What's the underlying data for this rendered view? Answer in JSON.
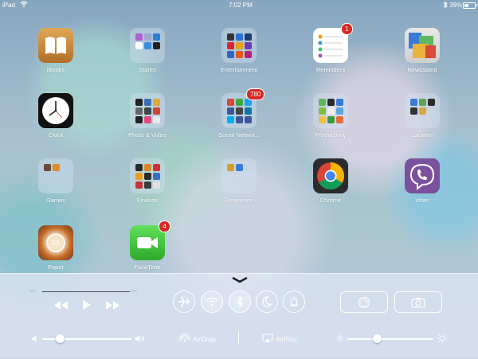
{
  "status_bar": {
    "device": "iPad",
    "time": "7:02 PM",
    "battery_text": "39%",
    "battery_level": 0.39
  },
  "apps": [
    {
      "label": "iBooks",
      "icon": "ibooks-icon"
    },
    {
      "label": "Stores",
      "icon": "folder-icon"
    },
    {
      "label": "Entertainment",
      "icon": "folder-icon"
    },
    {
      "label": "Reminders",
      "icon": "reminders-icon",
      "badge": "1"
    },
    {
      "label": "Newsstand",
      "icon": "newsstand-icon"
    },
    {
      "label": "Clock",
      "icon": "clock-icon"
    },
    {
      "label": "Photo & Video",
      "icon": "folder-icon"
    },
    {
      "label": "Social Networ...",
      "icon": "folder-icon",
      "badge": "780"
    },
    {
      "label": "Productivity",
      "icon": "folder-icon"
    },
    {
      "label": "Location",
      "icon": "folder-icon"
    },
    {
      "label": "Games",
      "icon": "folder-icon"
    },
    {
      "label": "Finance",
      "icon": "folder-icon"
    },
    {
      "label": "Reference",
      "icon": "folder-icon"
    },
    {
      "label": "Chrome",
      "icon": "chrome-icon"
    },
    {
      "label": "Viber",
      "icon": "viber-icon"
    },
    {
      "label": "Paper",
      "icon": "paper-icon"
    },
    {
      "label": "FaceTime",
      "icon": "facetime-icon",
      "badge": "4"
    }
  ],
  "control_center": {
    "elapsed": "--:--",
    "remaining": "--:--",
    "toggles": [
      {
        "name": "airplane-mode-toggle",
        "state": "off"
      },
      {
        "name": "wifi-toggle",
        "state": "on"
      },
      {
        "name": "bluetooth-toggle",
        "state": "on"
      },
      {
        "name": "do-not-disturb-toggle",
        "state": "off"
      },
      {
        "name": "rotation-lock-toggle",
        "state": "off"
      }
    ],
    "volume_level": 0.2,
    "brightness_level": 0.35,
    "airdrop_label": "AirDrop",
    "airplay_label": "AirPlay"
  },
  "colors": {
    "badge": "#d52a25",
    "facetime": "#3ec63c",
    "viber": "#7b519d"
  }
}
